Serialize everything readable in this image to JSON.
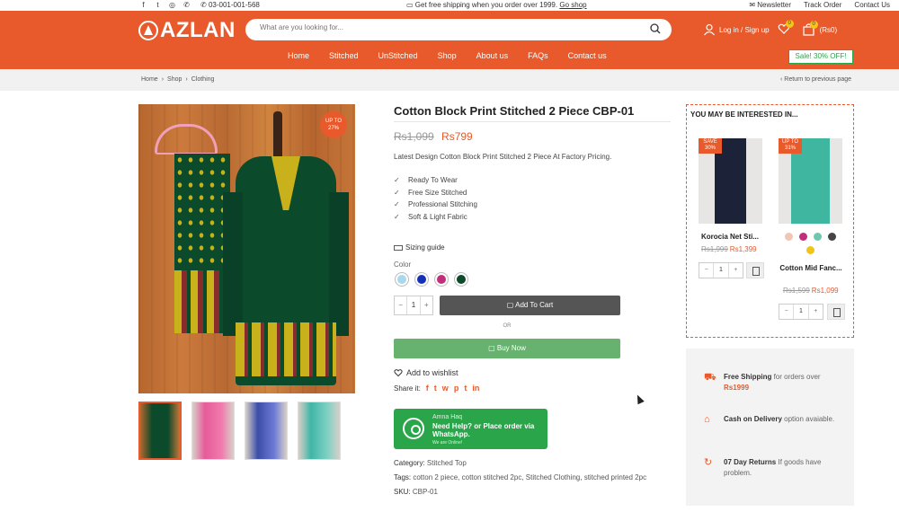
{
  "topbar": {
    "phone": "03-001-001-568",
    "shipping_text": "Get free shipping when you order over 1999.",
    "shipping_link": "Go shop",
    "links": [
      "Newsletter",
      "Track Order",
      "Contact Us"
    ]
  },
  "header": {
    "brand": "AZLAN",
    "search_placeholder": "What are you looking for...",
    "login_label": "Log in / Sign up",
    "wishlist_count": "0",
    "cart_count": "0",
    "cart_total": "(Rs0)"
  },
  "nav": {
    "items": [
      "Home",
      "Stitched",
      "UnStitched",
      "Shop",
      "About us",
      "FAQs",
      "Contact us"
    ],
    "sale_label": "Sale! 30% OFF!"
  },
  "breadcrumb": {
    "items": [
      "Home",
      "Shop",
      "Clothing"
    ],
    "return_label": "Return to previous page"
  },
  "product": {
    "badge": "UP TO 27%",
    "badge_line1": "UP TO",
    "badge_line2": "27%",
    "title": "Cotton Block Print Stitched 2 Piece CBP-01",
    "price_old": "Rs1,099",
    "price_new": "Rs799",
    "description": "Latest Design Cotton Block Print Stitched 2 Piece At Factory Pricing.",
    "features": [
      "Ready To Wear",
      "Free Size Stitched",
      "Professional Stitching",
      "Soft & Light Fabric"
    ],
    "sizing_guide": "Sizing guide",
    "color_label": "Color",
    "colors": [
      "#a8d8ec",
      "#1530b8",
      "#c0307a",
      "#0b4a2a"
    ],
    "quantity": "1",
    "add_to_cart": "Add To Cart",
    "or_label": "OR",
    "buy_now": "Buy Now",
    "wishlist_label": "Add to wishlist",
    "share_label": "Share it:",
    "share_icons": [
      "f",
      "t",
      "w",
      "p",
      "t",
      "in"
    ],
    "category_label": "Category:",
    "category_value": "Stitched Top",
    "tags_label": "Tags:",
    "tags_value": "cotton 2 piece, cotton stitched 2pc, Stitched Clothing, stitched printed 2pc",
    "sku_label": "SKU:",
    "sku_value": "CBP-01"
  },
  "whatsapp": {
    "agent": "Amna Haq",
    "message": "Need Help? or Place order via WhatsApp.",
    "status": "We are Online!"
  },
  "related": {
    "heading": "YOU MAY BE INTERESTED IN...",
    "items": [
      {
        "tag_line1": "SAVE",
        "tag_line2": "30%",
        "title": "Korocia Net Sti...",
        "old": "Rs1,999",
        "new": "Rs1,399",
        "qty": "1"
      },
      {
        "tag_line1": "UP TO",
        "tag_line2": "31%",
        "title": "Cotton Mid Fanc...",
        "old": "Rs1,599",
        "new": "Rs1,099",
        "qty": "1",
        "colors": [
          "#f2c6b4",
          "#c0307a",
          "#6fc7b0",
          "#444444",
          "#f0c419"
        ]
      }
    ]
  },
  "perks": [
    {
      "title": "Free Shipping",
      "text": " for orders over ",
      "highlight": "Rs1999"
    },
    {
      "title": "Cash on Delivery",
      "text": " option avaiable."
    },
    {
      "title": "07 Day Returns",
      "text": " If goods have problem."
    }
  ],
  "colors": {
    "accent": "#e85a2b",
    "buy_now": "#66b26e",
    "whatsapp": "#2aa54a",
    "add_to_cart": "#555555"
  }
}
